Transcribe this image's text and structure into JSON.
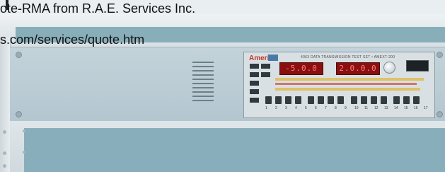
{
  "header": {
    "title": "ote-RMA from R.A.E. Services Inc.",
    "url": "s.com/services/quote.htm"
  },
  "instrument": {
    "brand": "Ameri",
    "model": "4063 DATA TRANSMISSION TEST SET • AMEXT-200",
    "display_left": "-5.0.0",
    "display_right": "2.0.0.0",
    "button_numbers": [
      "1",
      "2",
      "3",
      "4",
      "5",
      "6",
      "7",
      "8",
      "9",
      "10",
      "11",
      "12",
      "13",
      "14",
      "15",
      "16",
      "17"
    ]
  },
  "colors": {
    "display": "#8a0f0f",
    "display_text": "#ff7c7c",
    "slot": "#87aeb9",
    "panel": "#b8c9d1"
  }
}
